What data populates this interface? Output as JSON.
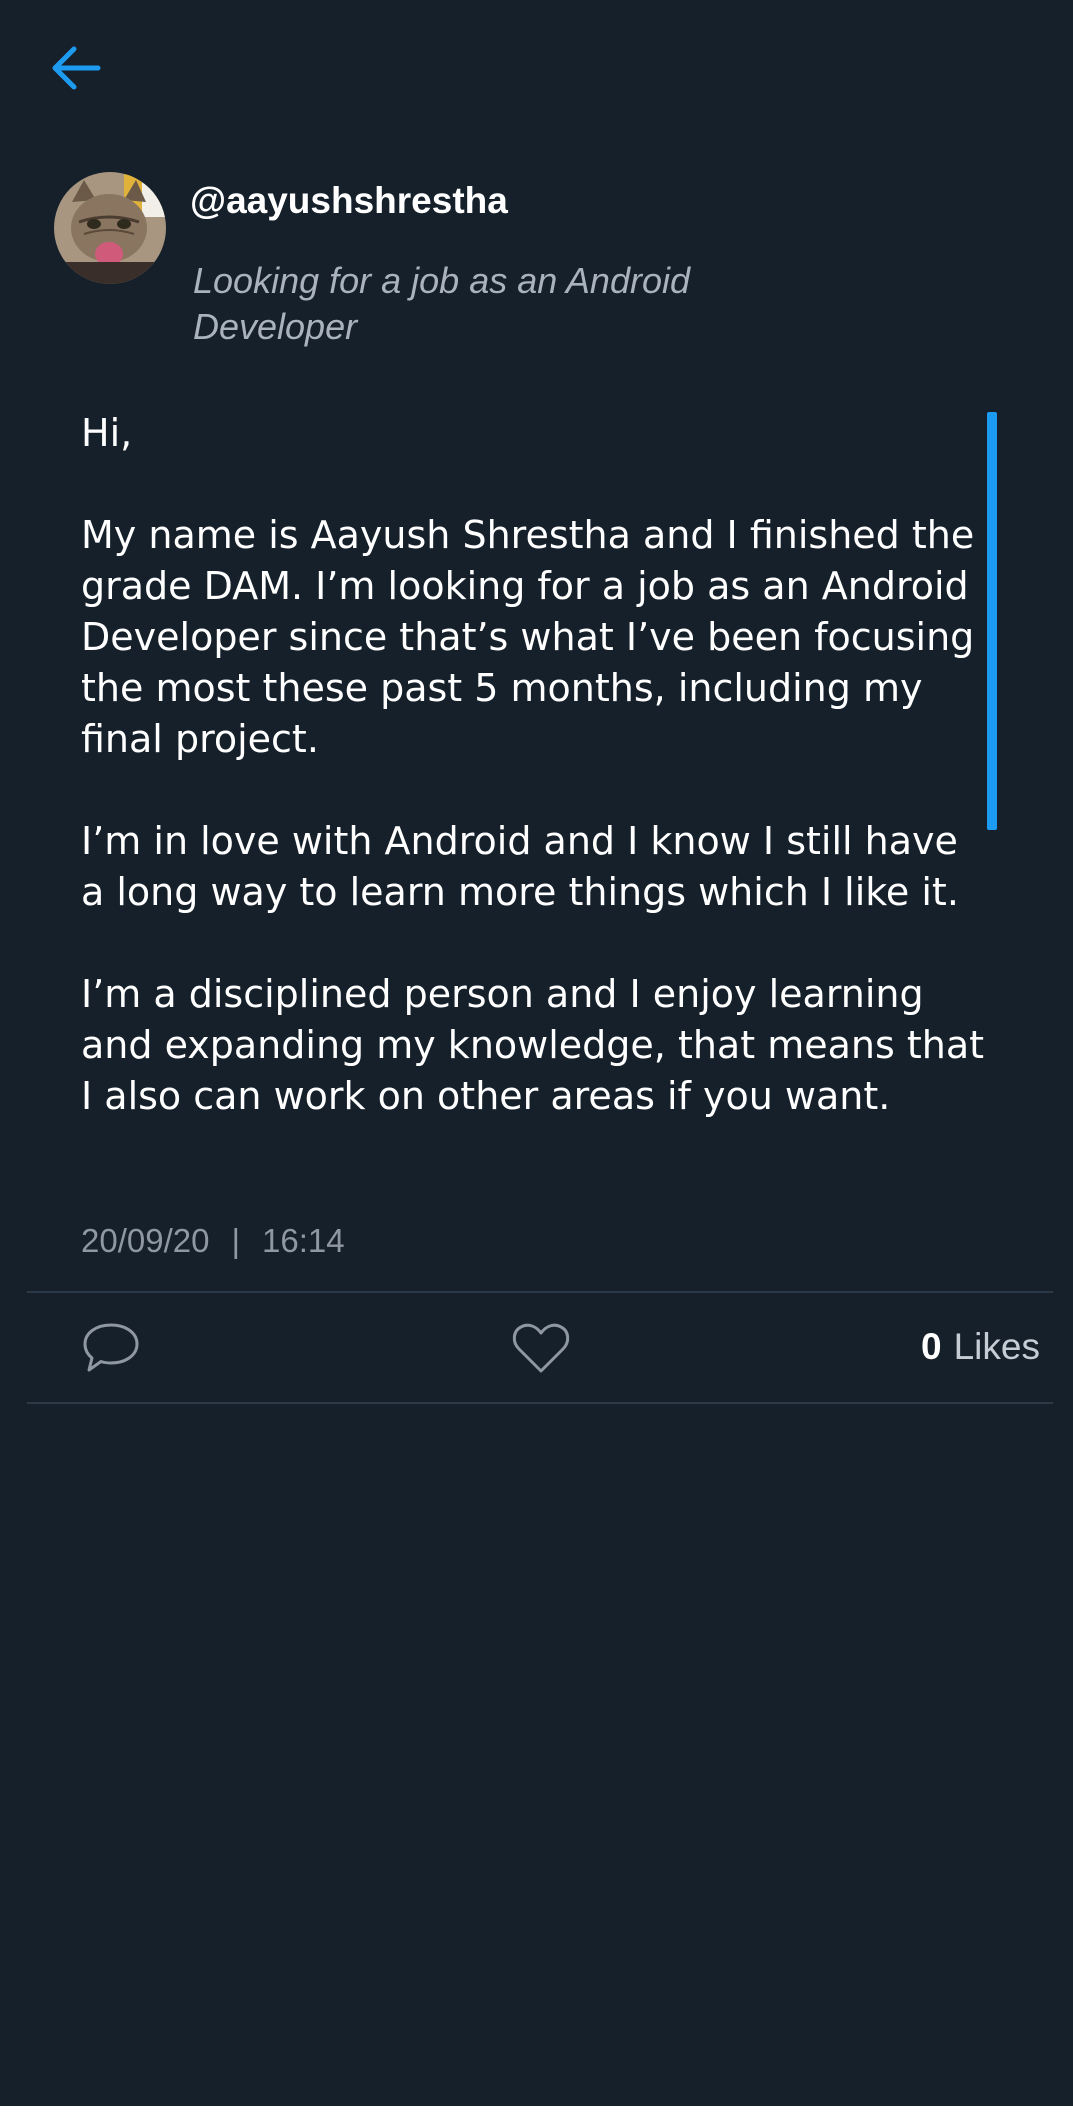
{
  "header": {
    "back_icon": "arrow-left-icon",
    "accent_color": "#1d9bf0"
  },
  "profile": {
    "username": "@aayushshrestha",
    "bio": "Looking for a job as an Android Developer",
    "avatar": "cat-avatar"
  },
  "post": {
    "body": "Hi,\n\nMy name is Aayush Shrestha and I finished the grade DAM. I’m looking for a job as an Android Developer since that’s what I’ve been focusing the most these past 5 months, including my final project.\n\nI’m in love with Android and I know I still have a long way to learn more things which I like it.\n\nI’m a disciplined person and I enjoy learning and expanding my knowledge, that means that I also can work on other areas if you want.",
    "date": "20/09/20",
    "separator": "|",
    "time": "16:14"
  },
  "actions": {
    "comment_icon": "comment-bubble-icon",
    "like_icon": "heart-icon",
    "likes_count": "0",
    "likes_label": "Likes"
  },
  "colors": {
    "background": "#15202b",
    "text_primary": "#ffffff",
    "text_secondary": "#8e97a2",
    "divider": "#2c3a47"
  }
}
